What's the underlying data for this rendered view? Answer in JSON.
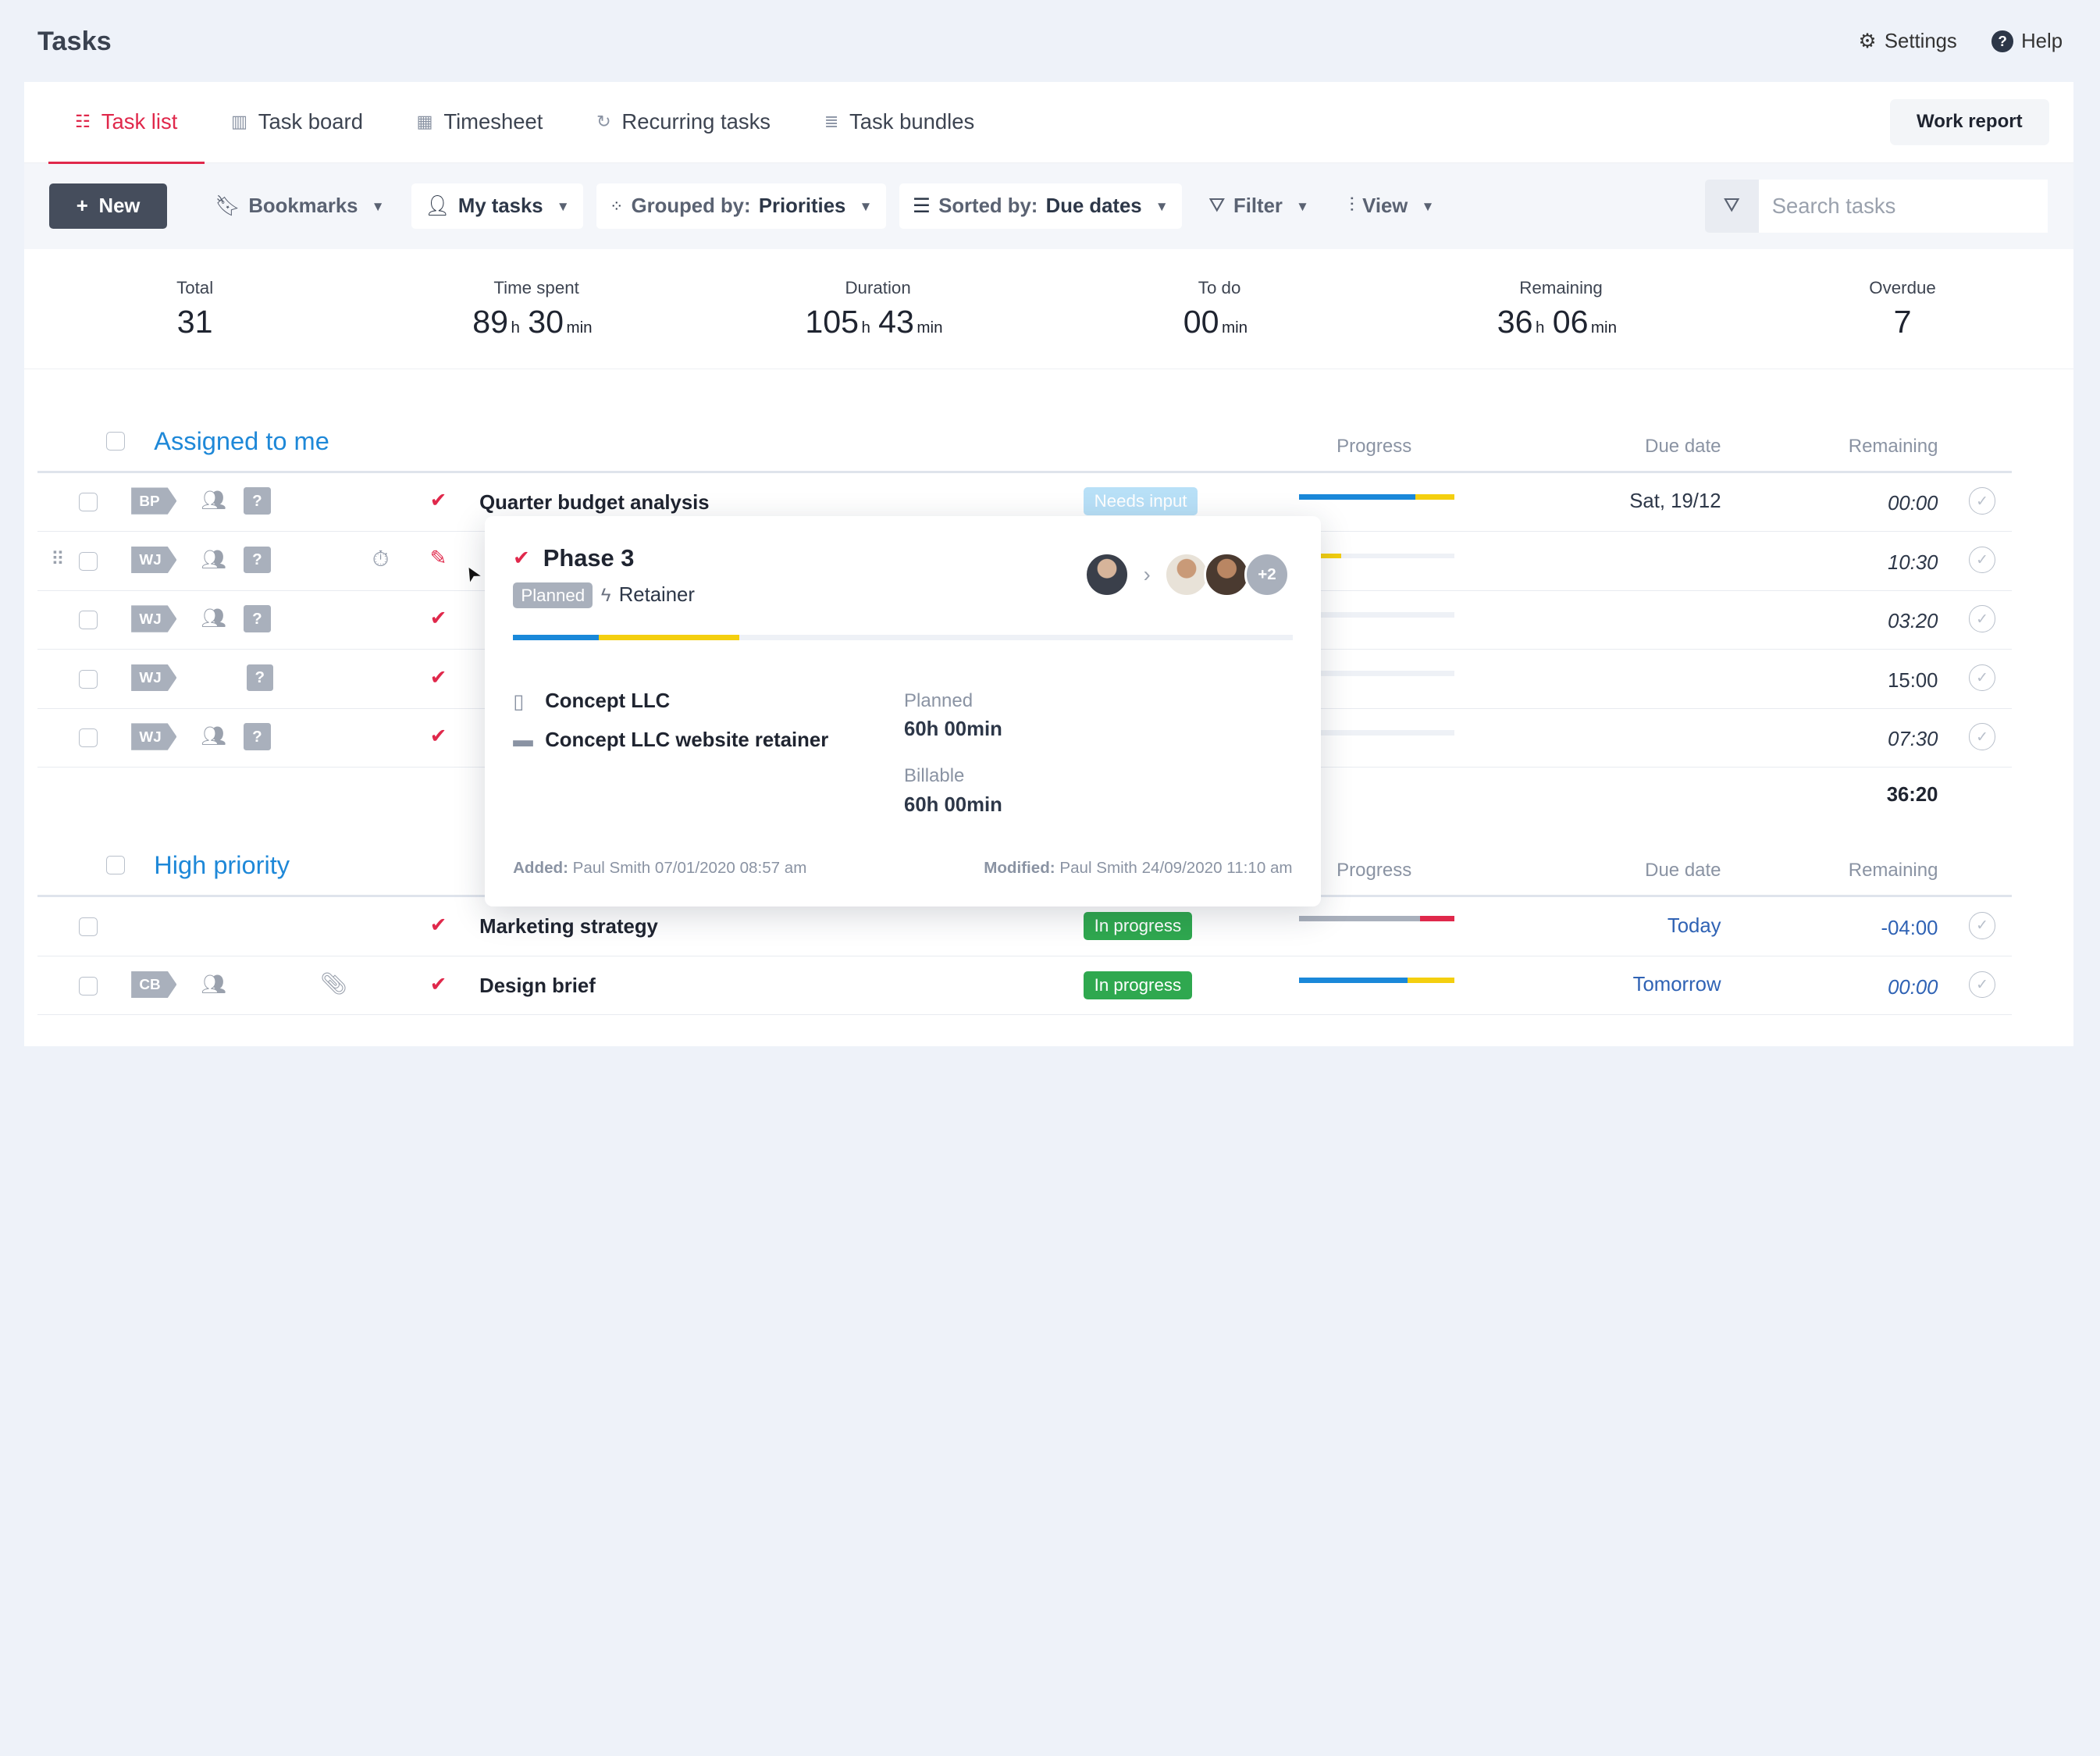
{
  "app": {
    "title": "Tasks"
  },
  "top_actions": {
    "settings": "Settings",
    "help": "Help",
    "help_icon": "?"
  },
  "tabs": [
    {
      "icon": "list-icon",
      "label": "Task list",
      "active": true
    },
    {
      "icon": "board-icon",
      "label": "Task board"
    },
    {
      "icon": "grid-icon",
      "label": "Timesheet"
    },
    {
      "icon": "refresh-icon",
      "label": "Recurring tasks"
    },
    {
      "icon": "stack-icon",
      "label": "Task bundles"
    }
  ],
  "work_report": "Work report",
  "toolbar": {
    "new_label": "New",
    "bookmarks": "Bookmarks",
    "my_tasks": "My tasks",
    "grouped_prefix": "Grouped by:",
    "grouped_value": "Priorities",
    "sorted_prefix": "Sorted by:",
    "sorted_value": "Due dates",
    "filter": "Filter",
    "view": "View",
    "search_placeholder": "Search tasks"
  },
  "stats": [
    {
      "label": "Total",
      "value": "31"
    },
    {
      "label": "Time spent",
      "h": "89",
      "m": "30"
    },
    {
      "label": "Duration",
      "h": "105",
      "m": "43"
    },
    {
      "label": "To do",
      "m": "00"
    },
    {
      "label": "Remaining",
      "h": "36",
      "m": "06"
    },
    {
      "label": "Overdue",
      "value": "7"
    }
  ],
  "units": {
    "h": "h",
    "min": "min"
  },
  "columns": {
    "progress": "Progress",
    "due": "Due date",
    "remaining": "Remaining"
  },
  "groups": {
    "assigned": {
      "title": "Assigned to me",
      "total": "36:20",
      "rows": [
        {
          "tag": "BP",
          "name": "Quarter budget analysis",
          "status": "Needs input",
          "due": "Sat, 19/12",
          "remaining": "00:00",
          "progress": [
            0.75,
            0.25
          ]
        },
        {
          "tag": "WJ",
          "remaining": "10:30",
          "progress": [
            0.1,
            0.17
          ]
        },
        {
          "tag": "WJ",
          "remaining": "03:20"
        },
        {
          "tag": "WJ",
          "remaining": "15:00"
        },
        {
          "tag": "WJ",
          "remaining": "07:30"
        }
      ]
    },
    "high": {
      "title": "High priority",
      "rows": [
        {
          "tag": "",
          "name": "Marketing strategy",
          "status": "In progress",
          "due": "Today",
          "remaining": "-04:00",
          "progress": [
            0.78,
            0.22
          ]
        },
        {
          "tag": "CB",
          "name": "Design brief",
          "status": "In progress",
          "due": "Tomorrow",
          "remaining": "00:00",
          "progress": [
            0.7,
            0.3
          ]
        }
      ]
    }
  },
  "popup": {
    "title": "Phase 3",
    "badge": "Planned",
    "type": "Retainer",
    "more_count": "+2",
    "progress": [
      0.11,
      0.18
    ],
    "client": "Concept LLC",
    "project": "Concept LLC website retainer",
    "planned_label": "Planned",
    "planned_value": "60h 00min",
    "billable_label": "Billable",
    "billable_value": "60h 00min",
    "added_label": "Added:",
    "added_value": "Paul Smith 07/01/2020 08:57 am",
    "modified_label": "Modified:",
    "modified_value": "Paul Smith 24/09/2020 11:10 am"
  },
  "colors": {
    "accent": "#e0284b",
    "blue": "#1e88d8",
    "bar_blue": "#1a88d9",
    "bar_yellow": "#f4cf0f",
    "bar_grey": "#a9b0bc",
    "bar_red": "#e0284b",
    "green": "#2fa84f"
  }
}
